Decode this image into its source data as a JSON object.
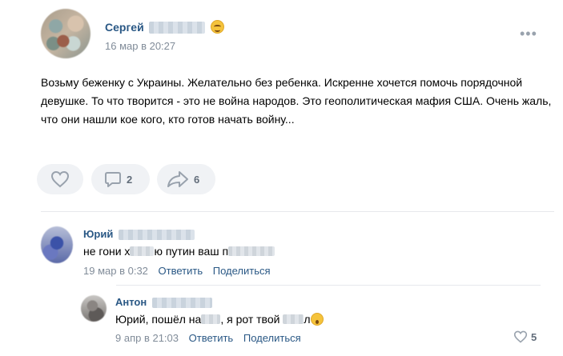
{
  "post": {
    "author_first_name": "Сергей",
    "date": "16 мар в 20:27",
    "more_menu": "•••",
    "text": "Возьму беженку с Украины. Желательно без ребенка. Искренне хочется помочь порядочной девушке. То что творится - это не война народов. Это геополитическая мафия США. Очень жаль, что они нашли кое кого, кто готов начать войну...",
    "comments_count": "2",
    "shares_count": "6"
  },
  "comments": [
    {
      "author_first_name": "Юрий",
      "text_part1": "не гони х",
      "text_part2": "ю путин ваш п",
      "date": "19 мар в 0:32",
      "reply_label": "Ответить",
      "share_label": "Поделиться"
    },
    {
      "author_first_name": "Антон",
      "text_part1": "Юрий, пошёл на",
      "text_part2": ", я рот твой",
      "text_part3": "л",
      "date": "9 апр в 21:03",
      "reply_label": "Ответить",
      "share_label": "Поделиться",
      "likes": "5"
    }
  ]
}
